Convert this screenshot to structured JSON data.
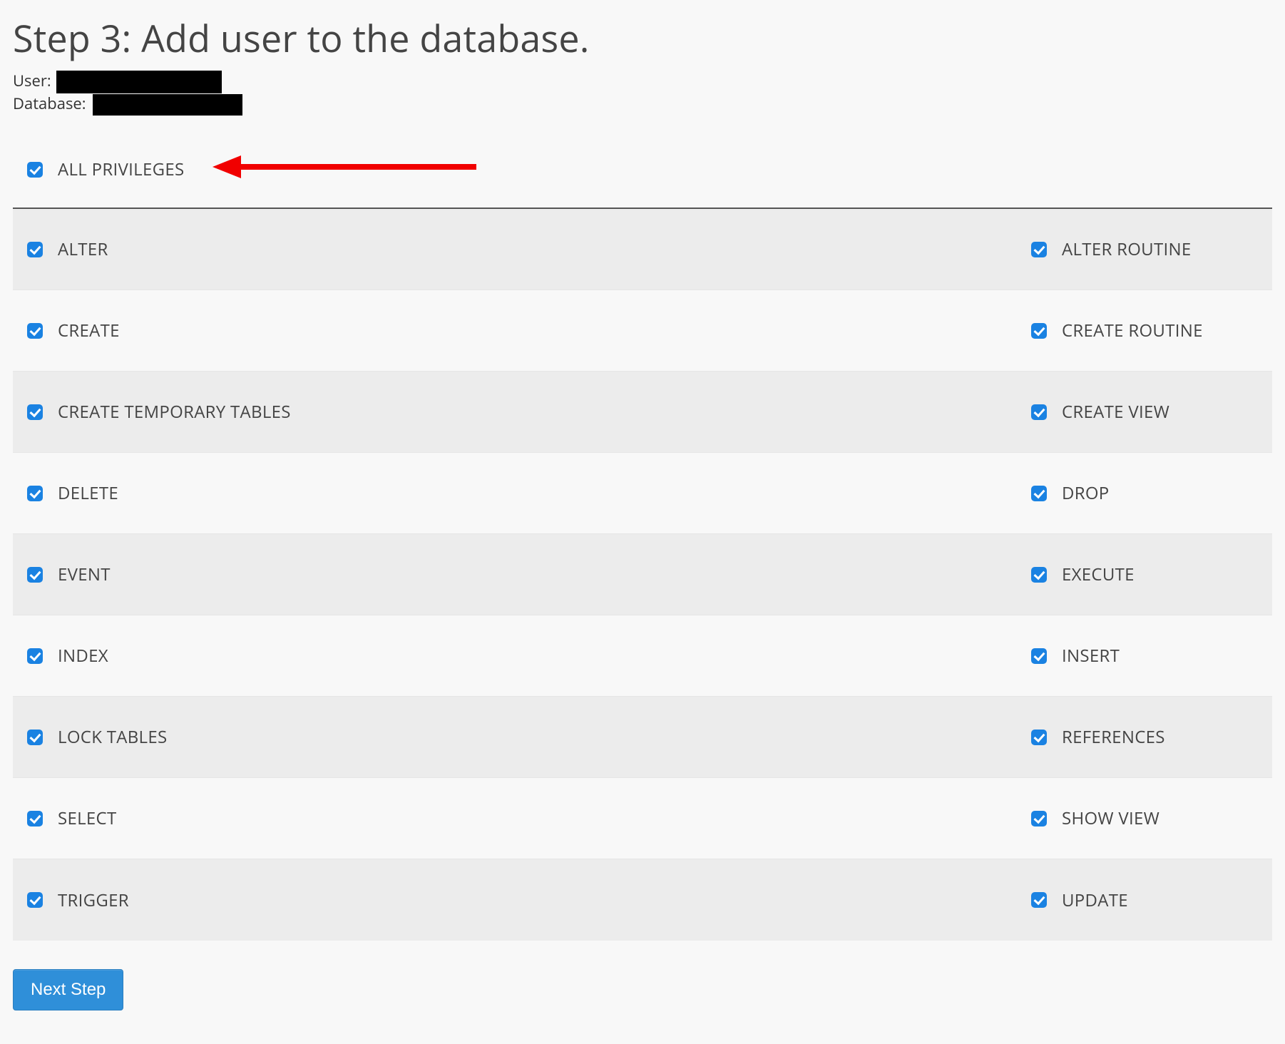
{
  "heading": "Step 3: Add user to the database.",
  "meta": {
    "user_label": "User:",
    "database_label": "Database:"
  },
  "all_privileges": {
    "label": "ALL PRIVILEGES",
    "checked": true
  },
  "privileges": [
    {
      "left": "ALTER",
      "right": "ALTER ROUTINE",
      "left_checked": true,
      "right_checked": true
    },
    {
      "left": "CREATE",
      "right": "CREATE ROUTINE",
      "left_checked": true,
      "right_checked": true
    },
    {
      "left": "CREATE TEMPORARY TABLES",
      "right": "CREATE VIEW",
      "left_checked": true,
      "right_checked": true
    },
    {
      "left": "DELETE",
      "right": "DROP",
      "left_checked": true,
      "right_checked": true
    },
    {
      "left": "EVENT",
      "right": "EXECUTE",
      "left_checked": true,
      "right_checked": true
    },
    {
      "left": "INDEX",
      "right": "INSERT",
      "left_checked": true,
      "right_checked": true
    },
    {
      "left": "LOCK TABLES",
      "right": "REFERENCES",
      "left_checked": true,
      "right_checked": true
    },
    {
      "left": "SELECT",
      "right": "SHOW VIEW",
      "left_checked": true,
      "right_checked": true
    },
    {
      "left": "TRIGGER",
      "right": "UPDATE",
      "left_checked": true,
      "right_checked": true
    }
  ],
  "button": {
    "next_step_label": "Next Step"
  },
  "annotation": {
    "arrow_color": "#f10000"
  }
}
